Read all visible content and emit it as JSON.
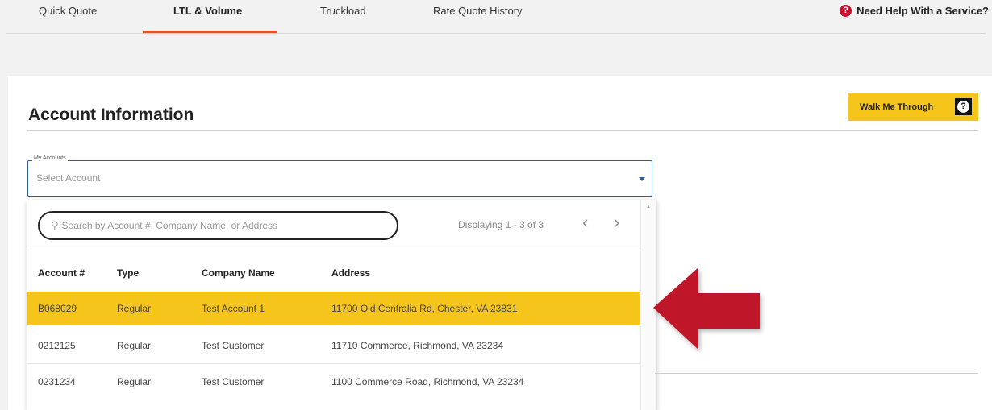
{
  "nav": {
    "tabs": [
      {
        "label": "Quick Quote"
      },
      {
        "label": "LTL & Volume"
      },
      {
        "label": "Truckload"
      },
      {
        "label": "Rate Quote History"
      }
    ],
    "help_label": "Need Help With a Service?"
  },
  "section": {
    "title": "Account Information",
    "walk_button": "Walk Me Through"
  },
  "account_select": {
    "legend": "My Accounts",
    "placeholder": "Select Account"
  },
  "dropdown": {
    "search_placeholder": "Search by Account #, Company Name, or Address",
    "paging_text": "Displaying 1 - 3 of 3",
    "columns": [
      "Account #",
      "Type",
      "Company Name",
      "Address"
    ],
    "rows": [
      {
        "account": "B068029",
        "type": "Regular",
        "company": "Test Account 1",
        "address": "11700 Old Centralia Rd, Chester, VA 23831"
      },
      {
        "account": "0212125",
        "type": "Regular",
        "company": "Test Customer",
        "address": "11710 Commerce, Richmond, VA 23234"
      },
      {
        "account": "0231234",
        "type": "Regular",
        "company": "Test Customer",
        "address": "1100 Commerce Road, Richmond, VA 23234"
      }
    ]
  },
  "colors": {
    "accent_tab": "#e0562c",
    "highlight": "#f6c51b",
    "arrow": "#c0192c",
    "help_icon": "#c8102e"
  },
  "icons": {
    "help": "question-circle-icon",
    "search": "search-icon",
    "prev": "chevron-left-icon",
    "next": "chevron-right-icon",
    "caret": "caret-down-icon",
    "arrow": "arrow-left-icon"
  }
}
